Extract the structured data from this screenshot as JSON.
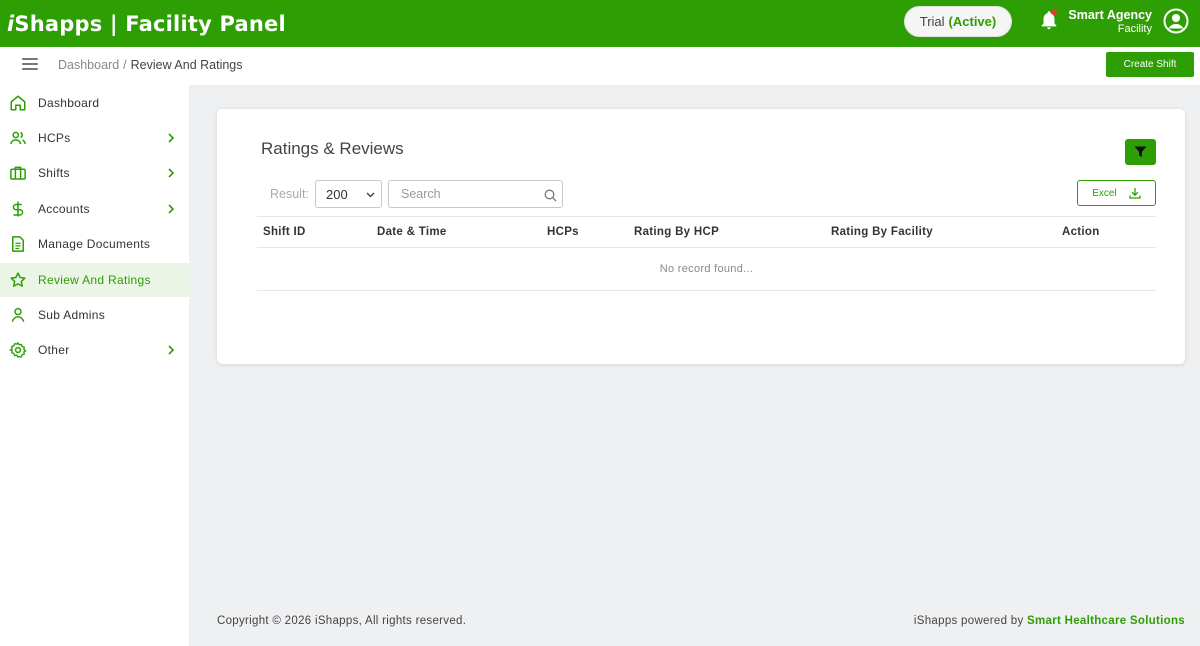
{
  "header": {
    "brand_prefix": "i",
    "brand_rest": "Shapps | Facility Panel",
    "trial_label": "Trial",
    "trial_status": "(Active)",
    "user_name": "Smart Agency",
    "user_role": "Facility"
  },
  "breadcrumb": {
    "root": "Dashboard",
    "separator": "/",
    "current": "Review And Ratings"
  },
  "toolbar": {
    "create_shift_label": "Create Shift"
  },
  "sidebar": {
    "items": [
      {
        "label": "Dashboard",
        "icon": "home-icon",
        "has_children": false
      },
      {
        "label": "HCPs",
        "icon": "users-icon",
        "has_children": true
      },
      {
        "label": "Shifts",
        "icon": "briefcase-icon",
        "has_children": true
      },
      {
        "label": "Accounts",
        "icon": "dollar-icon",
        "has_children": true
      },
      {
        "label": "Manage Documents",
        "icon": "document-icon",
        "has_children": false
      },
      {
        "label": "Review And Ratings",
        "icon": "star-icon",
        "has_children": false,
        "active": true
      },
      {
        "label": "Sub Admins",
        "icon": "user-icon",
        "has_children": false
      },
      {
        "label": "Other",
        "icon": "gear-icon",
        "has_children": true
      }
    ]
  },
  "card": {
    "title": "Ratings & Reviews",
    "result_label": "Result:",
    "result_value": "200",
    "search_placeholder": "Search",
    "excel_label": "Excel",
    "columns": [
      "Shift ID",
      "Date & Time",
      "HCPs",
      "Rating By HCP",
      "Rating By Facility",
      "Action"
    ],
    "empty_text": "No record found..."
  },
  "footer": {
    "copyright": "Copyright © 2026 iShapps, All rights reserved.",
    "powered_prefix": "iShapps powered by",
    "powered_brand": "Smart Healthcare Solutions"
  },
  "colors": {
    "accent": "#2e9e05",
    "sidebar_active_bg": "#eaf5e6",
    "page_bg": "#eff0f2"
  }
}
